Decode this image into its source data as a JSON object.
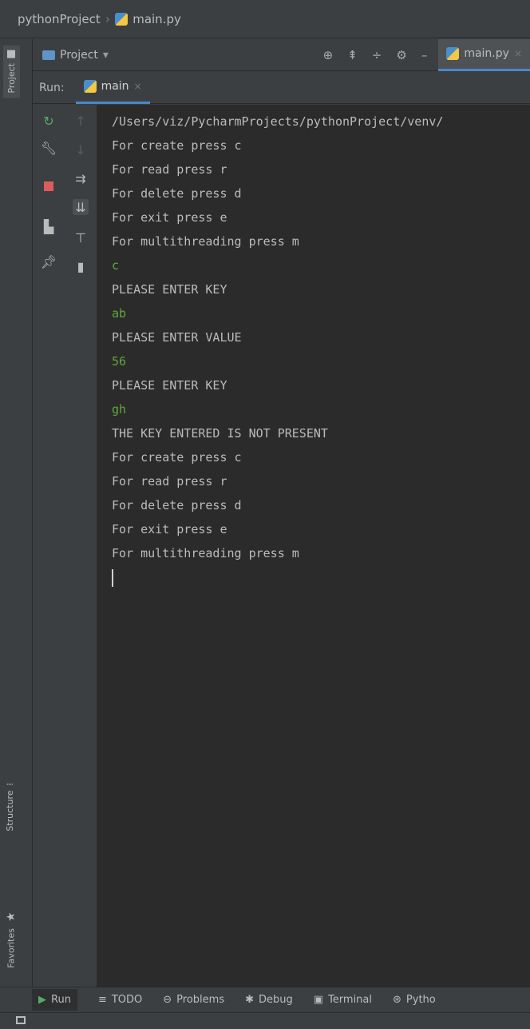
{
  "breadcrumb": {
    "project": "pythonProject",
    "file": "main.py"
  },
  "left_stripe": {
    "project": "Project",
    "structure": "Structure",
    "favorites": "Favorites"
  },
  "tool_header": {
    "title": "Project",
    "dropdown": "▾",
    "editor_tab": "main.py"
  },
  "run_header": {
    "label": "Run:",
    "tab": "main"
  },
  "console": {
    "lines": [
      {
        "text": "/Users/viz/PycharmProjects/pythonProject/venv/",
        "input": false
      },
      {
        "text": "For create press c",
        "input": false
      },
      {
        "text": "For read press r",
        "input": false
      },
      {
        "text": "For delete press d",
        "input": false
      },
      {
        "text": "For exit press e",
        "input": false
      },
      {
        "text": "For multithreading press m",
        "input": false
      },
      {
        "text": "c",
        "input": true
      },
      {
        "text": "PLEASE ENTER KEY",
        "input": false
      },
      {
        "text": "ab",
        "input": true
      },
      {
        "text": "PLEASE ENTER VALUE",
        "input": false
      },
      {
        "text": "56",
        "input": true
      },
      {
        "text": "PLEASE ENTER KEY",
        "input": false
      },
      {
        "text": "gh",
        "input": true
      },
      {
        "text": "THE KEY ENTERED IS NOT PRESENT",
        "input": false
      },
      {
        "text": "For create press c",
        "input": false
      },
      {
        "text": "For read press r",
        "input": false
      },
      {
        "text": "For delete press d",
        "input": false
      },
      {
        "text": "For exit press e",
        "input": false
      },
      {
        "text": "For multithreading press m",
        "input": false
      }
    ]
  },
  "bottom_tabs": {
    "run": "Run",
    "todo": "TODO",
    "problems": "Problems",
    "debug": "Debug",
    "terminal": "Terminal",
    "python": "Pytho"
  },
  "colors": {
    "console_bg": "#2b2b2b",
    "input_text": "#5fa83b",
    "accent": "#4a88c7"
  }
}
